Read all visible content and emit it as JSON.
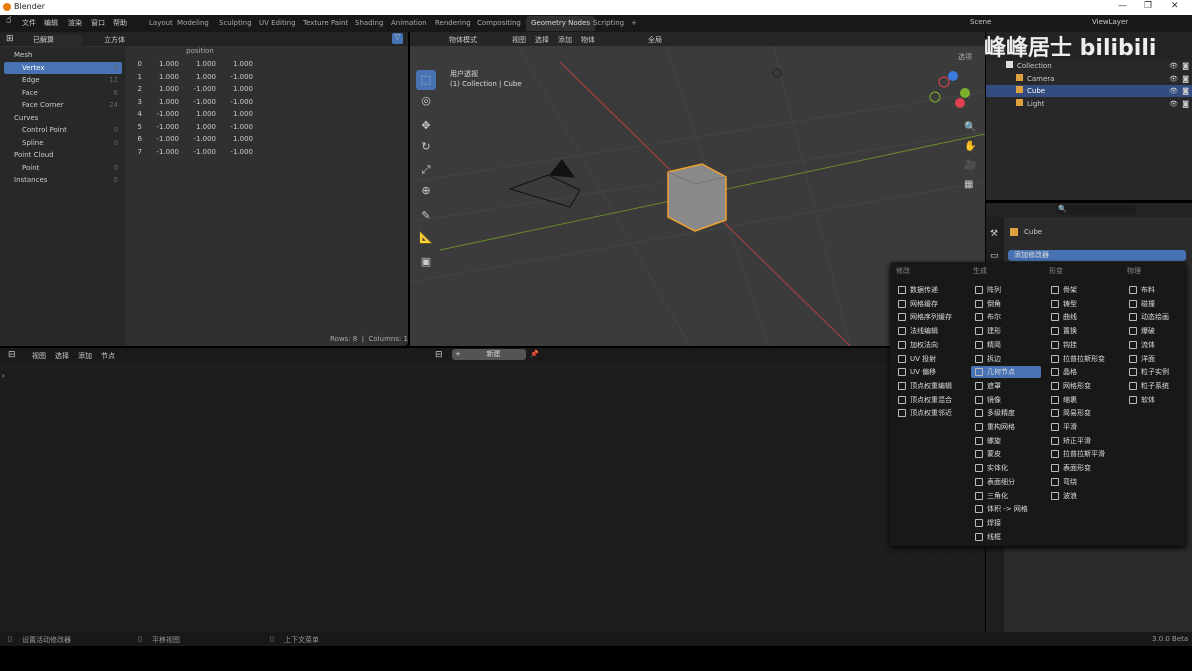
{
  "window": {
    "title": "Blender",
    "minimize": "—",
    "maximize": "❐",
    "close": "✕"
  },
  "topbar": {
    "menus": [
      "文件",
      "编辑",
      "渲染",
      "窗口",
      "帮助"
    ],
    "workspaces": [
      "Layout",
      "Modeling",
      "Sculpting",
      "UV Editing",
      "Texture Paint",
      "Shading",
      "Animation",
      "Rendering",
      "Compositing",
      "Geometry Nodes",
      "Scripting",
      "+"
    ],
    "active_workspace": "Geometry Nodes",
    "scene": "Scene",
    "view_layer": "ViewLayer"
  },
  "spreadsheet": {
    "mode": "已解算",
    "object": "立方体",
    "column_header": "position",
    "domains": [
      {
        "label": "Mesh",
        "count": "",
        "level": 0
      },
      {
        "label": "Vertex",
        "count": "8",
        "level": 1,
        "selected": true
      },
      {
        "label": "Edge",
        "count": "12",
        "level": 1
      },
      {
        "label": "Face",
        "count": "6",
        "level": 1
      },
      {
        "label": "Face Corner",
        "count": "24",
        "level": 1
      },
      {
        "label": "Curves",
        "count": "",
        "level": 0
      },
      {
        "label": "Control Point",
        "count": "0",
        "level": 1
      },
      {
        "label": "Spline",
        "count": "0",
        "level": 1
      },
      {
        "label": "Point Cloud",
        "count": "",
        "level": 0
      },
      {
        "label": "Point",
        "count": "0",
        "level": 1
      },
      {
        "label": "Instances",
        "count": "0",
        "level": 0
      }
    ],
    "rows": [
      [
        "0",
        "1.000",
        "1.000",
        "1.000"
      ],
      [
        "1",
        "1.000",
        "1.000",
        "-1.000"
      ],
      [
        "2",
        "1.000",
        "-1.000",
        "1.000"
      ],
      [
        "3",
        "1.000",
        "-1.000",
        "-1.000"
      ],
      [
        "4",
        "-1.000",
        "1.000",
        "1.000"
      ],
      [
        "5",
        "-1.000",
        "1.000",
        "-1.000"
      ],
      [
        "6",
        "-1.000",
        "-1.000",
        "1.000"
      ],
      [
        "7",
        "-1.000",
        "-1.000",
        "-1.000"
      ]
    ],
    "footer_rows": "Rows: 8",
    "footer_sep": "|",
    "footer_cols": "Columns: 1"
  },
  "viewport": {
    "mode": "物体模式",
    "menus": [
      "视图",
      "选择",
      "添加",
      "物体"
    ],
    "transform": "全局",
    "overlay_label": "选项",
    "view_name": "用户透视",
    "view_info": "(1) Collection | Cube"
  },
  "outliner": {
    "items": [
      {
        "label": "Collection",
        "level": 0
      },
      {
        "label": "Camera",
        "level": 1
      },
      {
        "label": "Cube",
        "level": 1,
        "selected": true
      },
      {
        "label": "Light",
        "level": 1
      }
    ]
  },
  "watermark": "峰峰居士 bilibili",
  "properties": {
    "object": "Cube",
    "add_modifier": "添加修改器"
  },
  "modifier_menu": {
    "columns": [
      {
        "title": "修改",
        "items": [
          "数据传递",
          "网格缓存",
          "网格序列缓存",
          "法线编辑",
          "加权法向",
          "UV 投射",
          "UV 偏移",
          "顶点权重编辑",
          "顶点权重混合",
          "顶点权重邻近"
        ]
      },
      {
        "title": "生成",
        "items": [
          "阵列",
          "倒角",
          "布尔",
          "建形",
          "精简",
          "拆边",
          "几何节点",
          "遮罩",
          "镜像",
          "多级精度",
          "重构网格",
          "螺旋",
          "蒙皮",
          "实体化",
          "表面细分",
          "三角化",
          "体积 -> 网格",
          "焊接",
          "线框"
        ]
      },
      {
        "title": "形变",
        "items": [
          "骨架",
          "铸型",
          "曲线",
          "置换",
          "钩挂",
          "拉普拉斯形变",
          "晶格",
          "网格形变",
          "缩裹",
          "简易形变",
          "平滑",
          "矫正平滑",
          "拉普拉斯平滑",
          "表面形变",
          "弯绕",
          "波浪"
        ]
      },
      {
        "title": "物理",
        "items": [
          "布料",
          "碰撞",
          "动态绘画",
          "爆破",
          "流体",
          "洋面",
          "粒子实例",
          "粒子系统",
          "软体"
        ]
      }
    ],
    "highlighted": "几何节点"
  },
  "node_editor": {
    "menus": [
      "视图",
      "选择",
      "添加",
      "节点"
    ],
    "new_button": "新建"
  },
  "status": {
    "left": "设置活动修改器",
    "mid": "平移视图",
    "right": "上下文菜单",
    "version": "3.0.0 Beta"
  },
  "colors": {
    "accent": "#4772b3",
    "selection": "#e87d0d"
  }
}
